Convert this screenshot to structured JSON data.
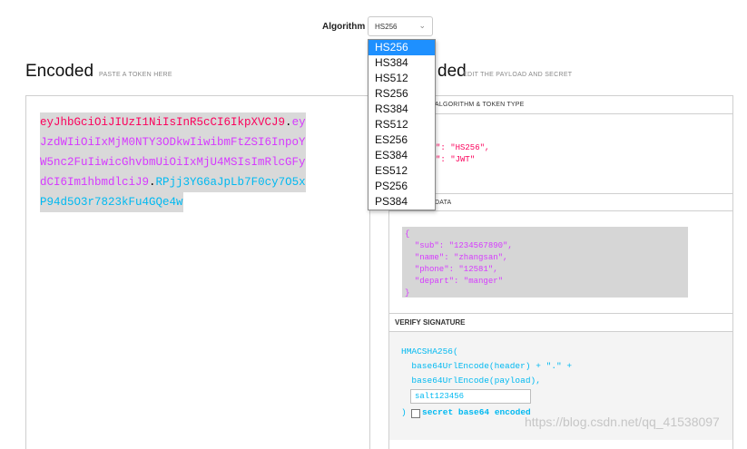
{
  "algorithm": {
    "label": "Algorithm",
    "selected": "HS256",
    "options": [
      "HS256",
      "HS384",
      "HS512",
      "RS256",
      "RS384",
      "RS512",
      "ES256",
      "ES384",
      "ES512",
      "PS256",
      "PS384"
    ]
  },
  "encoded": {
    "title": "Encoded",
    "hint": "PASTE A TOKEN HERE",
    "token_lines": [
      {
        "parts": [
          {
            "t": "eyJhbGciOiJIUzI1NiIsInR5cCI6IkpXVCJ9",
            "c": "red"
          },
          {
            "t": ".",
            "c": "dot"
          },
          {
            "t": "ey",
            "c": "mag"
          }
        ]
      },
      {
        "parts": [
          {
            "t": "JzdWIiOiIxMjM0NTY3ODkwIiwibmFtZSI6InpoY",
            "c": "mag"
          }
        ]
      },
      {
        "parts": [
          {
            "t": "W5nc2FuIiwicGhvbmUiOiIxMjU4MSIsImRlcGFy",
            "c": "mag"
          }
        ]
      },
      {
        "parts": [
          {
            "t": "dCI6Im1hbmdlciJ9",
            "c": "mag"
          },
          {
            "t": ".",
            "c": "dot"
          },
          {
            "t": "RPjj3YG6aJpLb7F0cy7O5x",
            "c": "cyan"
          }
        ]
      },
      {
        "parts": [
          {
            "t": "P94d5O3r7823kFu4GQe4w",
            "c": "cyan"
          }
        ]
      }
    ]
  },
  "decoded": {
    "title_tail": "ded",
    "hint": "EDIT THE PAYLOAD AND SECRET",
    "header_section": "ALGORITHM & TOKEN TYPE",
    "header_json": "\": \"HS256\",\n\": \"JWT\"",
    "payload_section": "DATA",
    "payload_json": "{\n  \"sub\": \"1234567890\",\n  \"name\": \"zhangsan\",\n  \"phone\": \"12581\",\n  \"depart\": \"manger\"\n}",
    "verify_section": "VERIFY SIGNATURE",
    "verify_code": "HMACSHA256(\n  base64UrlEncode(header) + \".\" +\n  base64UrlEncode(payload),",
    "secret_value": "salt123456",
    "close_paren": ")",
    "base64_label": "secret base64 encoded",
    "base64_checked": false
  },
  "watermark": "https://blog.csdn.net/qq_41538097",
  "colors": {
    "header": "#fb015b",
    "payload": "#d63aff",
    "signature": "#00b9f1",
    "dropdown_selected": "#1e90ff"
  }
}
